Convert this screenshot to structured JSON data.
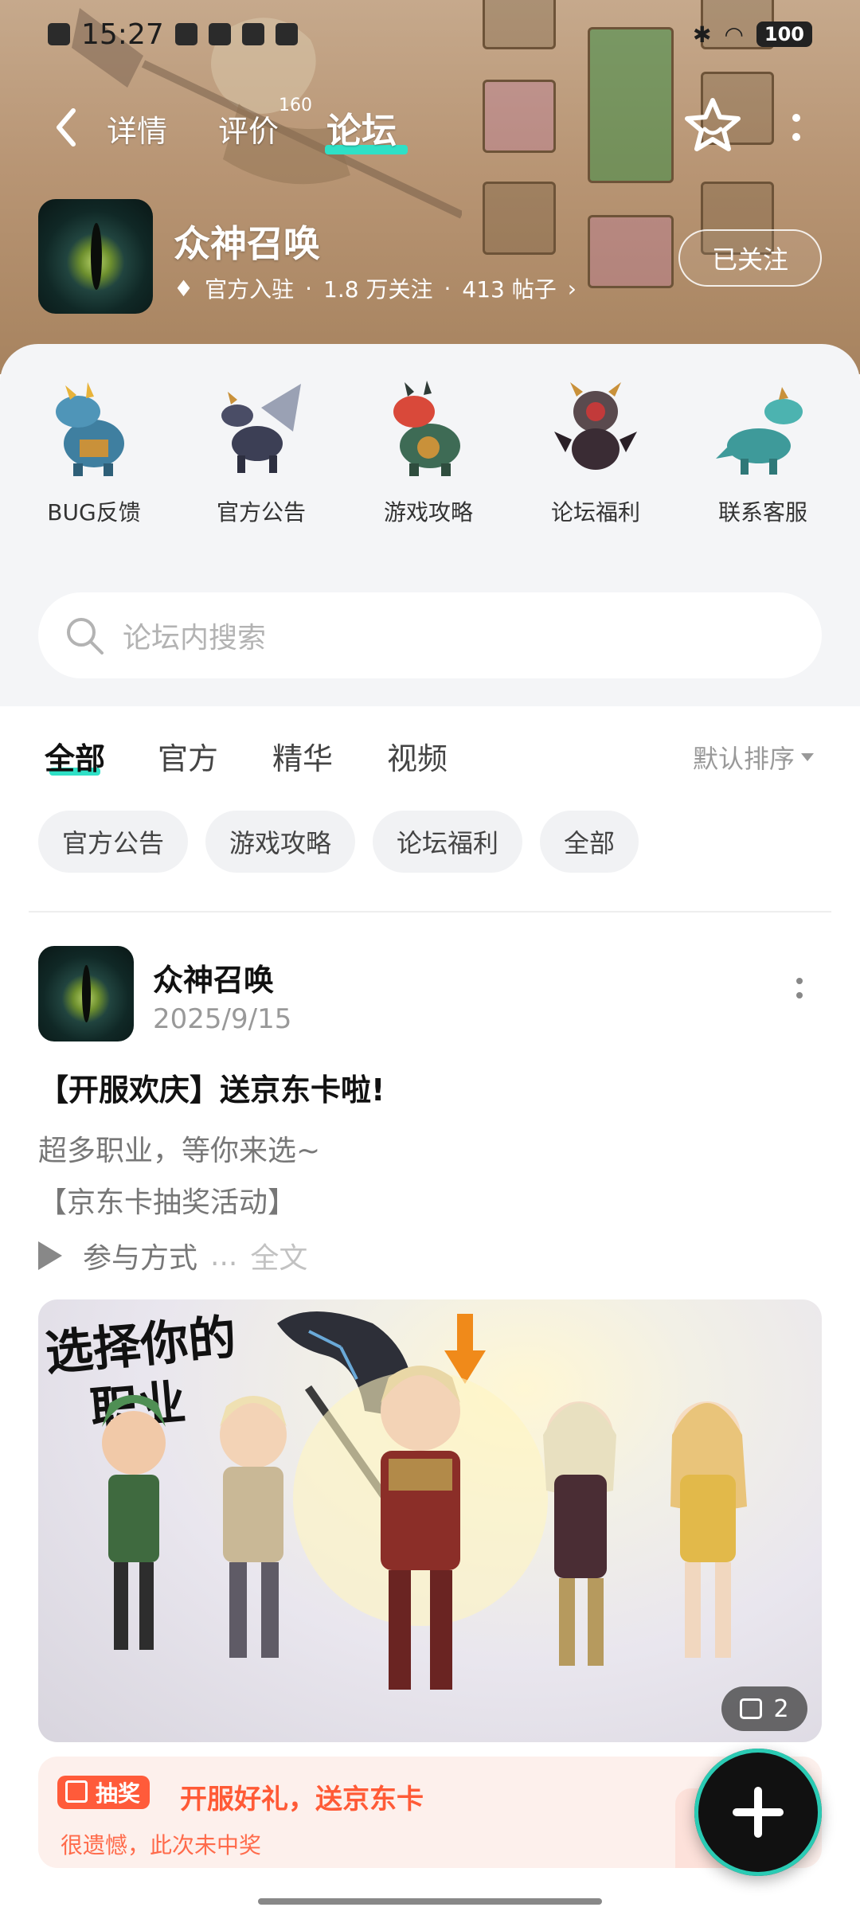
{
  "status_bar": {
    "time": "15:27",
    "battery": "100"
  },
  "nav": {
    "tabs": [
      {
        "label": "详情",
        "active": false
      },
      {
        "label": "评价",
        "badge": "160",
        "active": false
      },
      {
        "label": "论坛",
        "active": true
      }
    ]
  },
  "game": {
    "name": "众神召唤",
    "official": "官方入驻",
    "followers": "1.8 万关注",
    "posts": "413 帖子",
    "follow_button": "已关注"
  },
  "shortcuts": [
    {
      "label": "BUG反馈",
      "icon": "dragon-blue-icon"
    },
    {
      "label": "官方公告",
      "icon": "dragon-winged-icon"
    },
    {
      "label": "游戏攻略",
      "icon": "dragon-red-icon"
    },
    {
      "label": "论坛福利",
      "icon": "dragon-armored-icon"
    },
    {
      "label": "联系客服",
      "icon": "dragon-teal-icon"
    }
  ],
  "search": {
    "placeholder": "论坛内搜索"
  },
  "filter_tabs": [
    "全部",
    "官方",
    "精华",
    "视频"
  ],
  "sort_label": "默认排序",
  "chips": [
    "官方公告",
    "游戏攻略",
    "论坛福利",
    "全部"
  ],
  "post": {
    "author": "众神召唤",
    "date": "2025/9/15",
    "title": "【开服欢庆】送京东卡啦!",
    "line1": "超多职业，等你来选~",
    "line2": "【京东卡抽奖活动】",
    "line3": "参与方式",
    "ellipsis": "...",
    "full_text": "全文",
    "image_headline_1": "选择你的",
    "image_headline_2": "职业",
    "image_count": "2",
    "lottery": {
      "tag": "抽奖",
      "title": "开服好礼，送京东卡",
      "subtitle": "很遗憾，此次未中奖"
    }
  },
  "colors": {
    "accent": "#2fe0c6",
    "lottery_red": "#ff5a36"
  }
}
